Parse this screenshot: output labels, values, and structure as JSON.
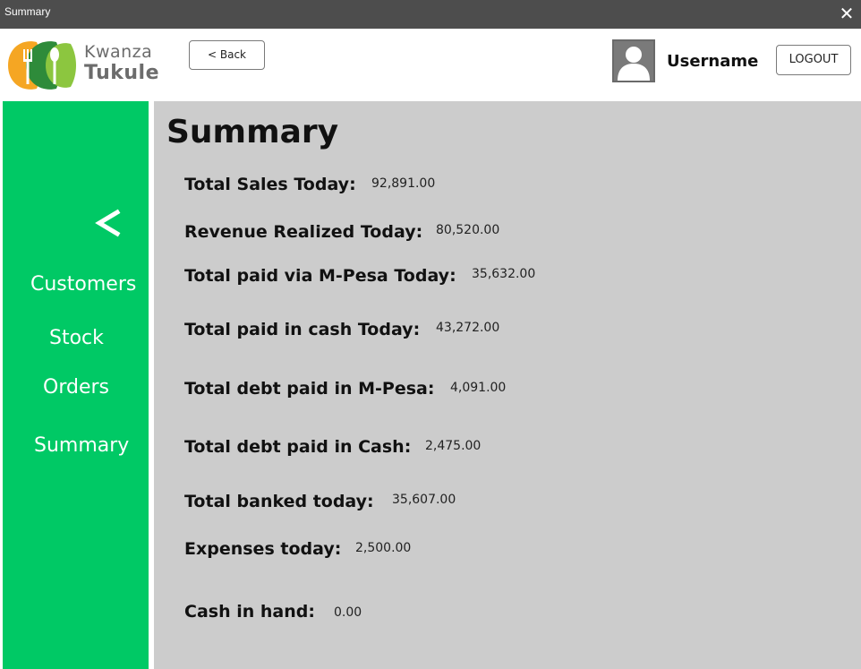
{
  "window": {
    "title": "Summary",
    "close_glyph": "✕"
  },
  "header": {
    "brand_line1": "Kwanza",
    "brand_line2": "Tukule",
    "back_label": "< Back",
    "username": "Username",
    "logout_label": "LOGOUT"
  },
  "sidebar": {
    "back_icon": "chevron-left-icon",
    "items": [
      {
        "label": "Customers"
      },
      {
        "label": "Stock"
      },
      {
        "label": "Orders"
      },
      {
        "label": "Summary"
      }
    ]
  },
  "summary": {
    "title": "Summary",
    "rows": [
      {
        "label": "Total Sales Today:",
        "value": "92,891.00"
      },
      {
        "label": "Revenue Realized Today:",
        "value": "80,520.00"
      },
      {
        "label": "Total paid via M-Pesa Today:",
        "value": "35,632.00"
      },
      {
        "label": "Total paid in cash Today:",
        "value": "43,272.00"
      },
      {
        "label": "Total debt paid in M-Pesa:",
        "value": "4,091.00"
      },
      {
        "label": "Total debt paid in Cash:",
        "value": "2,475.00"
      },
      {
        "label": "Total banked today:",
        "value": "35,607.00"
      },
      {
        "label": "Expenses today:",
        "value": "2,500.00"
      },
      {
        "label": "Cash in hand:",
        "value": "0.00"
      }
    ]
  },
  "colors": {
    "titlebar": "#4d4d4d",
    "sidebar": "#00c965",
    "main_bg": "#cccccc",
    "logo_orange": "#f5a623",
    "logo_green": "#3aa845"
  }
}
